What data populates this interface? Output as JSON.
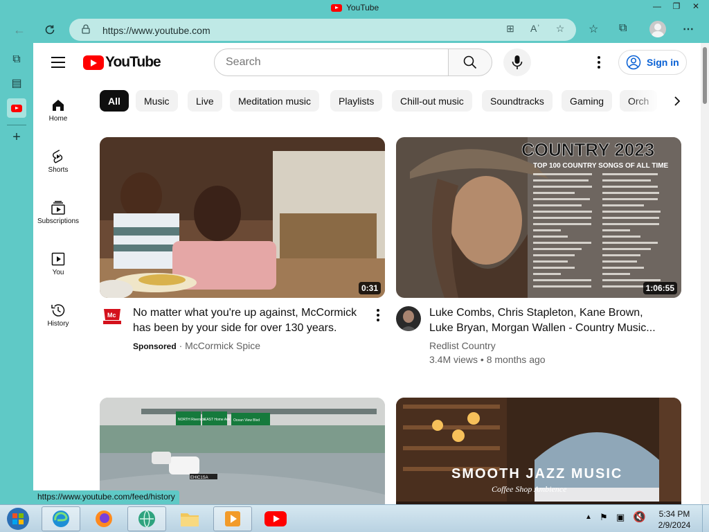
{
  "window": {
    "title": "YouTube"
  },
  "browser": {
    "url": "https://www.youtube.com",
    "status_url": "https://www.youtube.com/feed/history"
  },
  "youtube": {
    "logo_text": "YouTube",
    "search_placeholder": "Search",
    "sign_in": "Sign in",
    "rail": [
      "Home",
      "Shorts",
      "Subscriptions",
      "You",
      "History"
    ],
    "chips": [
      "All",
      "Music",
      "Live",
      "Meditation music",
      "Playlists",
      "Chill-out music",
      "Soundtracks",
      "Gaming",
      "Orch"
    ],
    "videos": [
      {
        "title_line1": "No matter what you're up against, McCormick",
        "title_line2": "has been by your side for over 130 years.",
        "sponsored": "Sponsored",
        "channel": "McCormick Spice",
        "duration": "0:31"
      },
      {
        "title_line1": "Luke Combs, Chris Stapleton, Kane Brown,",
        "title_line2": "Luke Bryan, Morgan Wallen - Country Music...",
        "channel": "Redlist Country",
        "views": "3.4M views",
        "age": "8 months ago",
        "duration": "1:06:55",
        "thumb_heading": "COUNTRY 2023",
        "thumb_sub": "TOP 100 COUNTRY SONGS OF ALL TIME"
      },
      {
        "sign1": "NORTH Riverside",
        "sign2": "EAST Home Ave",
        "sign3": "Ocean View Blvd",
        "plate": "EHIC1SA"
      },
      {
        "thumb_heading": "SMOOTH JAZZ MUSIC",
        "thumb_sub": "Coffee Shop Ambience"
      }
    ]
  },
  "taskbar": {
    "time": "5:34 PM",
    "date": "2/9/2024"
  }
}
